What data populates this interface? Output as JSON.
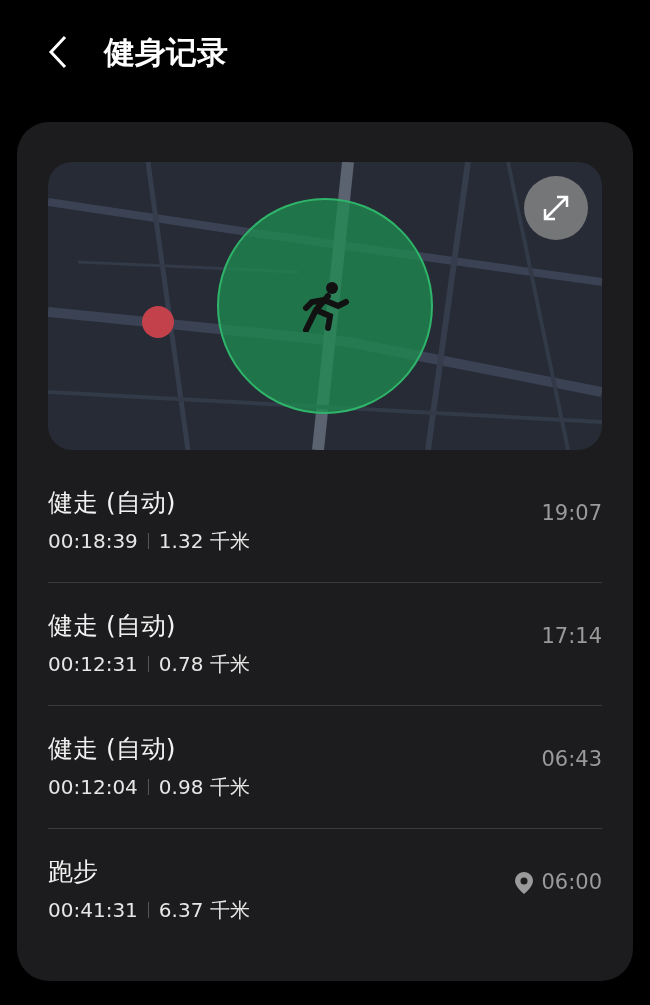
{
  "header": {
    "title": "健身记录"
  },
  "records": [
    {
      "name": "健走 (自动)",
      "duration": "00:18:39",
      "distance": "1.32 千米",
      "time": "19:07",
      "location_pin": false
    },
    {
      "name": "健走 (自动)",
      "duration": "00:12:31",
      "distance": "0.78 千米",
      "time": "17:14",
      "location_pin": false
    },
    {
      "name": "健走 (自动)",
      "duration": "00:12:04",
      "distance": "0.98 千米",
      "time": "06:43",
      "location_pin": false
    },
    {
      "name": "跑步",
      "duration": "00:41:31",
      "distance": "6.37 千米",
      "time": "06:00",
      "location_pin": true
    }
  ]
}
